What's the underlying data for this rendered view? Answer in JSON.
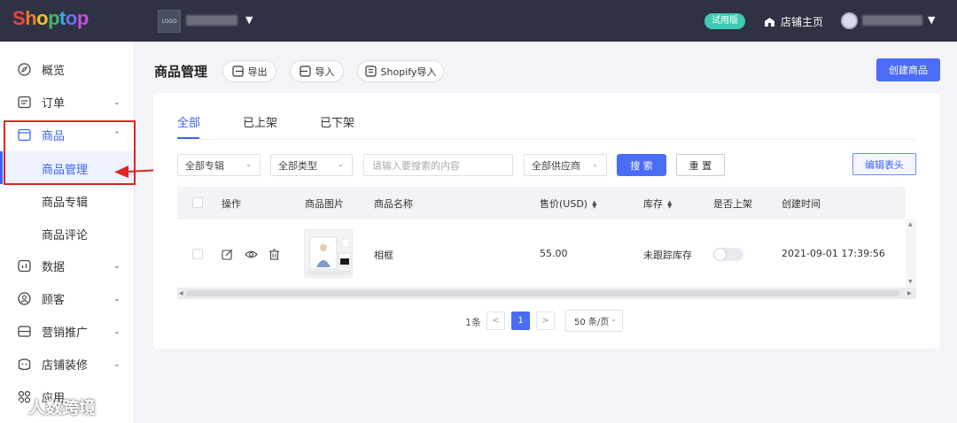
{
  "brand": {
    "name": "Shoptop",
    "letters": [
      "S",
      "h",
      "o",
      "p",
      "t",
      "o",
      "p"
    ],
    "letter_colors": [
      "#e84545",
      "#ee7a2d",
      "#f2c230",
      "#3fb96f",
      "#38a8f0",
      "#6c6ff2",
      "#c94fd8"
    ]
  },
  "topbar": {
    "store_logo_text": "LOGO",
    "trial_badge": "试用版",
    "home_link": "店铺主页"
  },
  "sidebar": {
    "items": [
      {
        "label": "概览",
        "icon": "compass-icon"
      },
      {
        "label": "订单",
        "icon": "order-icon",
        "chevron": "⌄"
      },
      {
        "label": "商品",
        "icon": "product-icon",
        "chevron": "⌃"
      },
      {
        "label": "数据",
        "icon": "chart-icon",
        "chevron": "⌄"
      },
      {
        "label": "顾客",
        "icon": "customer-icon",
        "chevron": "⌄"
      },
      {
        "label": "营销推广",
        "icon": "marketing-icon",
        "chevron": "⌄"
      },
      {
        "label": "店铺装修",
        "icon": "decorate-icon",
        "chevron": "⌄"
      },
      {
        "label": "应用",
        "icon": "apps-icon"
      }
    ],
    "sub_items": [
      "商品管理",
      "商品专辑",
      "商品评论"
    ]
  },
  "header": {
    "title": "商品管理",
    "export_label": "导出",
    "import_label": "导入",
    "shopify_import_label": "Shopify导入",
    "create_label": "创建商品"
  },
  "tabs": [
    "全部",
    "已上架",
    "已下架"
  ],
  "filters": {
    "collection": "全部专辑",
    "type": "全部类型",
    "search_placeholder": "请输入要搜索的内容",
    "supplier": "全部供应商",
    "search_label": "搜 索",
    "reset_label": "重 置",
    "edit_columns_label": "编辑表头"
  },
  "table": {
    "columns": [
      "操作",
      "商品图片",
      "商品名称",
      "售价(USD)",
      "库存",
      "是否上架",
      "创建时间"
    ],
    "rows": [
      {
        "name": "相框",
        "price": "55.00",
        "stock": "未跟踪库存",
        "listed": false,
        "created": "2021-09-01 17:39:56"
      }
    ]
  },
  "pagination": {
    "total": "1条",
    "current_page": "1",
    "page_size": "50 条/页",
    "prev": "<",
    "next": ">"
  },
  "watermark": {
    "text": "人数跨境"
  },
  "colors": {
    "accent": "#4a6cf7",
    "topbar": "#2e3242",
    "annotation": "#e02424",
    "trial": "#3fc8b4"
  }
}
